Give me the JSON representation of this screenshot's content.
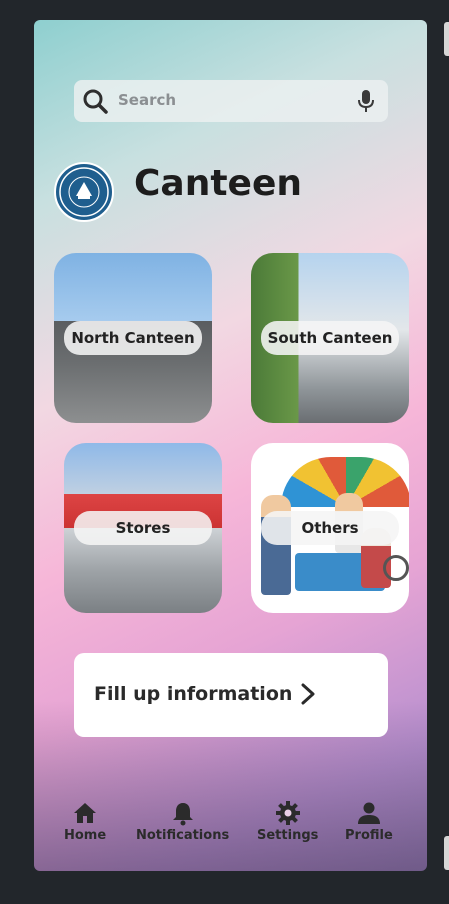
{
  "search": {
    "placeholder": "Search",
    "icon": "search-icon",
    "mic_icon": "microphone-icon"
  },
  "header": {
    "title": "Canteen",
    "logo": "university-seal"
  },
  "cards": [
    {
      "label": "North Canteen"
    },
    {
      "label": "South Canteen"
    },
    {
      "label": "Stores"
    },
    {
      "label": "Others"
    }
  ],
  "fill_card": {
    "label": "Fill up information",
    "icon": "chevron-right-icon"
  },
  "nav": [
    {
      "label": "Home",
      "icon": "home-icon"
    },
    {
      "label": "Notifications",
      "icon": "bell-icon"
    },
    {
      "label": "Settings",
      "icon": "gear-icon"
    },
    {
      "label": "Profile",
      "icon": "person-icon"
    }
  ],
  "colors": {
    "background": "#22262b",
    "card": "#ffffff",
    "text": "#1d1d1d",
    "seal": "#1f5e8e"
  }
}
